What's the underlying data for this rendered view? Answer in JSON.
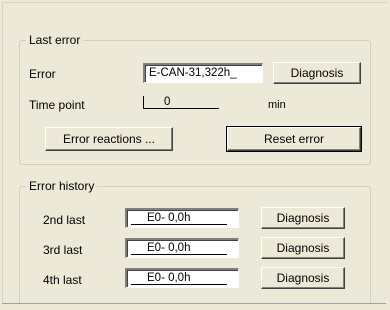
{
  "last_error": {
    "legend": "Last error",
    "error_label": "Error",
    "error_value": "E-CAN-31,322h_",
    "diagnosis_label": "Diagnosis",
    "time_point_label": "Time point",
    "time_point_value": "0",
    "time_unit": "min",
    "error_reactions_label": "Error reactions ...",
    "reset_error_label": "Reset error"
  },
  "error_history": {
    "legend": "Error history",
    "rows": [
      {
        "label": "2nd last",
        "value": "E0- 0,0h",
        "button": "Diagnosis"
      },
      {
        "label": "3rd last",
        "value": "E0- 0,0h",
        "button": "Diagnosis"
      },
      {
        "label": "4th last",
        "value": "E0- 0,0h",
        "button": "Diagnosis"
      }
    ]
  }
}
